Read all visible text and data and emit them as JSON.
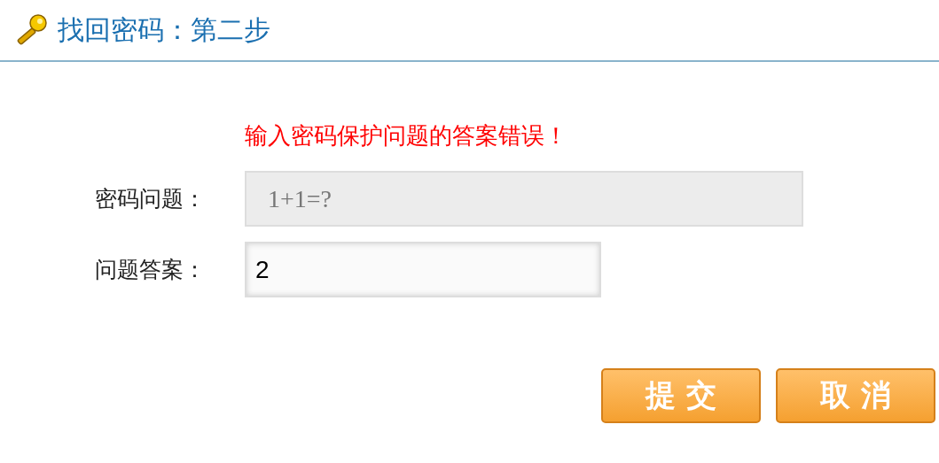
{
  "header": {
    "title": "找回密码：第二步"
  },
  "error": "输入密码保护问题的答案错误！",
  "fields": [
    {
      "label": "密码问题：",
      "value": "1+1=?",
      "disabled": true
    },
    {
      "label": "问题答案：",
      "value": "2",
      "disabled": false
    }
  ],
  "buttons": [
    "提 交",
    "取 消"
  ]
}
